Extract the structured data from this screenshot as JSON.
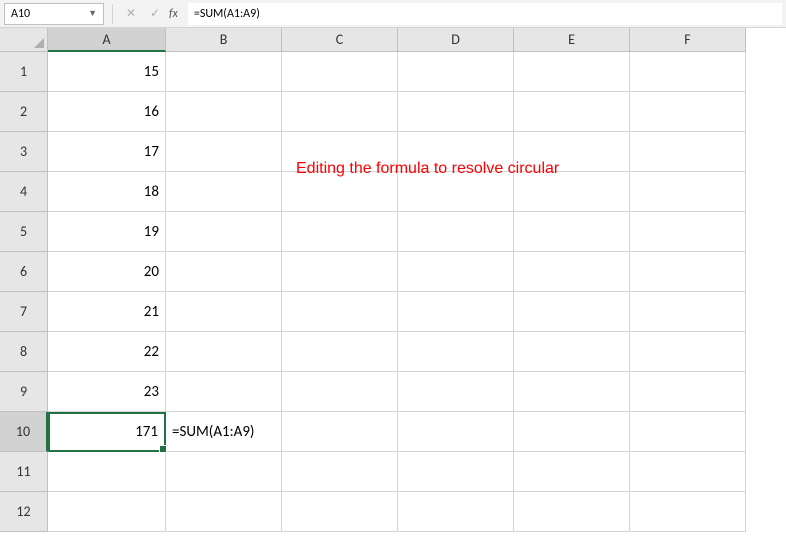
{
  "formula_bar": {
    "name_box": "A10",
    "formula": "=SUM(A1:A9)"
  },
  "columns": [
    "A",
    "B",
    "C",
    "D",
    "E",
    "F"
  ],
  "rows": [
    "1",
    "2",
    "3",
    "4",
    "5",
    "6",
    "7",
    "8",
    "9",
    "10",
    "11",
    "12"
  ],
  "cells": {
    "A1": "15",
    "A2": "16",
    "A3": "17",
    "A4": "18",
    "A5": "19",
    "A6": "20",
    "A7": "21",
    "A8": "22",
    "A9": "23",
    "A10": "171",
    "B10": "=SUM(A1:A9)"
  },
  "active_cell": "A10",
  "annotation": "Editing the formula to resolve circular",
  "chart_data": {
    "type": "table",
    "title": "Excel spreadsheet with SUM formula",
    "categories": [
      "A1",
      "A2",
      "A3",
      "A4",
      "A5",
      "A6",
      "A7",
      "A8",
      "A9",
      "A10"
    ],
    "values": [
      15,
      16,
      17,
      18,
      19,
      20,
      21,
      22,
      23,
      171
    ],
    "formula": "=SUM(A1:A9)"
  }
}
